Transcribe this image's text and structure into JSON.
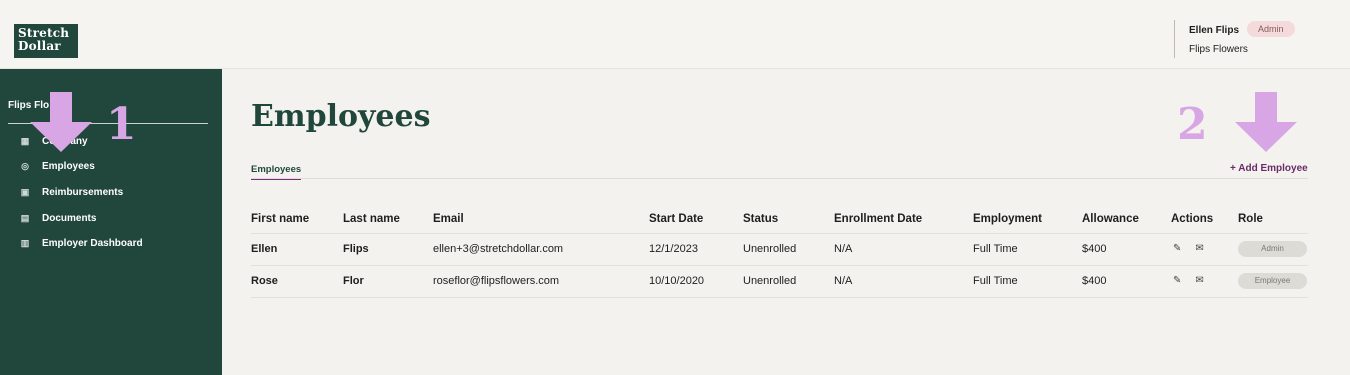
{
  "header": {
    "logo_line1": "Stretch",
    "logo_line2": "Dollar",
    "user_name": "Ellen Flips",
    "user_role_badge": "Admin",
    "company": "Flips Flowers"
  },
  "sidebar": {
    "company": "Flips Flo",
    "items": [
      {
        "label": "Company",
        "icon": "building-icon"
      },
      {
        "label": "Employees",
        "icon": "user-icon"
      },
      {
        "label": "Reimbursements",
        "icon": "dollar-icon"
      },
      {
        "label": "Documents",
        "icon": "document-icon"
      },
      {
        "label": "Employer Dashboard",
        "icon": "dashboard-icon"
      }
    ]
  },
  "main": {
    "title": "Employees",
    "tab": "Employees",
    "add_button": "+ Add Employee"
  },
  "table": {
    "columns": [
      "First name",
      "Last name",
      "Email",
      "Start Date",
      "Status",
      "Enrollment Date",
      "Employment",
      "Allowance",
      "Actions",
      "Role"
    ],
    "rows": [
      {
        "first": "Ellen",
        "last": "Flips",
        "email": "ellen+3@stretchdollar.com",
        "start": "12/1/2023",
        "status": "Unenrolled",
        "enroll": "N/A",
        "employment": "Full Time",
        "allowance": "$400",
        "role": "Admin"
      },
      {
        "first": "Rose",
        "last": "Flor",
        "email": "roseflor@flipsflowers.com",
        "start": "10/10/2020",
        "status": "Unenrolled",
        "enroll": "N/A",
        "employment": "Full Time",
        "allowance": "$400",
        "role": "Employee"
      }
    ]
  },
  "annotations": {
    "step1": "1",
    "step2": "2",
    "arrow_color": "#d8a6e5"
  }
}
